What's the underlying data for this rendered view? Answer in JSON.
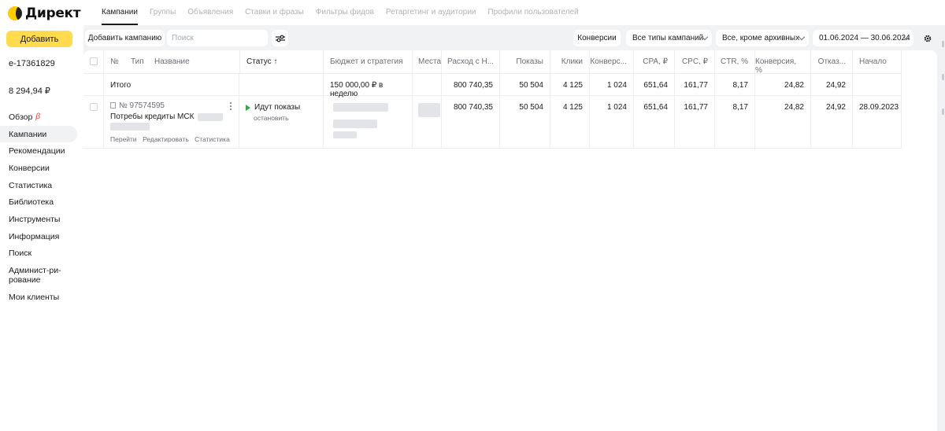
{
  "app": {
    "logo_text": "Директ"
  },
  "sidebar": {
    "add_label": "Добавить",
    "login": "e-17361829",
    "balance": "8 294,94 ₽",
    "items": [
      {
        "label": "Обзор",
        "badge": "β"
      },
      {
        "label": "Кампании"
      },
      {
        "label": "Рекомендации"
      },
      {
        "label": "Конверсии"
      },
      {
        "label": "Статистика"
      },
      {
        "label": "Библиотека"
      },
      {
        "label": "Инструменты"
      },
      {
        "label": "Информация"
      },
      {
        "label": "Поиск"
      },
      {
        "label": "Админист-ри-\nрование"
      },
      {
        "label": "Мои клиенты"
      }
    ]
  },
  "tabs": [
    "Кампании",
    "Группы",
    "Объявления",
    "Ставки и фразы",
    "Фильтры фидов",
    "Ретаргетинг и аудитории",
    "Профили пользователей"
  ],
  "toolbar": {
    "add_campaign": "Добавить кампанию",
    "search_placeholder": "Поиск",
    "conversions": "Конверсии",
    "campaign_types": "Все типы кампаний",
    "archive_filter": "Все, кроме архивных",
    "date_range": "01.06.2024 — 30.06.2024"
  },
  "table": {
    "headers": {
      "num": "№",
      "type": "Тип",
      "name": "Название",
      "status": "Статус ↑",
      "budget": "Бюджет и стратегия",
      "places": "Места",
      "spend": "Расход с Н...",
      "impressions": "Показы",
      "clicks": "Клики",
      "conversions": "Конверс...",
      "cpa": "CPA, ₽",
      "cpc": "CPC, ₽",
      "ctr": "CTR, %",
      "conv_rate": "Конверсия, %",
      "bounce": "Отказ...",
      "start": "Начало"
    },
    "total": {
      "label": "Итого",
      "budget": "150 000,00 ₽ в неделю",
      "spend": "800 740,35",
      "impressions": "50 504",
      "clicks": "4 125",
      "conversions": "1 024",
      "cpa": "651,64",
      "cpc": "161,77",
      "ctr": "8,17",
      "conv_rate": "24,82",
      "bounce": "24,92"
    },
    "rows": [
      {
        "number": "№ 97574595",
        "name": "Потребы кредиты МСК",
        "links": [
          "Перейти",
          "Редактировать",
          "Статистика"
        ],
        "status": "Идут показы",
        "status_action": "остановить",
        "spend": "800 740,35",
        "impressions": "50 504",
        "clicks": "4 125",
        "conversions": "1 024",
        "cpa": "651,64",
        "cpc": "161,77",
        "ctr": "8,17",
        "conv_rate": "24,82",
        "bounce": "24,92",
        "start": "28.09.2023"
      }
    ]
  },
  "colors": {
    "accent_yellow": "#ffdb4d",
    "status_green": "#37a64f",
    "beta_red": "#e0403a"
  }
}
